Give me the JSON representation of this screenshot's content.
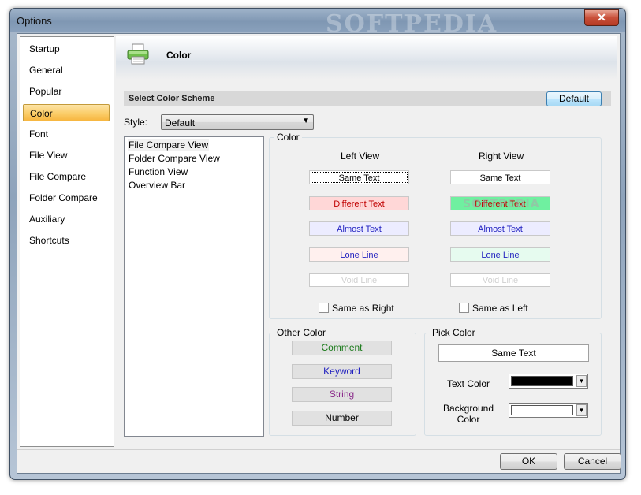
{
  "window": {
    "title": "Options",
    "close_glyph": "✕",
    "titlebar_watermark": "SOFTPEDIA"
  },
  "nav": {
    "items": [
      {
        "label": "Startup"
      },
      {
        "label": "General"
      },
      {
        "label": "Popular"
      },
      {
        "label": "Color",
        "selected": true
      },
      {
        "label": "Font"
      },
      {
        "label": "File View"
      },
      {
        "label": "File Compare"
      },
      {
        "label": "Folder Compare"
      },
      {
        "label": "Auxiliary"
      },
      {
        "label": "Shortcuts"
      }
    ]
  },
  "header": {
    "title": "Color",
    "icon": "printer-icon"
  },
  "scheme": {
    "label": "Select Color Scheme",
    "default_button": "Default"
  },
  "style": {
    "label": "Style:",
    "value": "Default"
  },
  "view_list": {
    "items": [
      {
        "label": "File Compare View",
        "selected": true
      },
      {
        "label": "Folder Compare View"
      },
      {
        "label": "Function View"
      },
      {
        "label": "Overview Bar"
      }
    ]
  },
  "color_group": {
    "title": "Color",
    "left_view": {
      "label": "Left View",
      "samples": [
        {
          "text": "Same Text",
          "fg": "#000000",
          "bg": "#ffffff",
          "focused": true
        },
        {
          "text": "Different Text",
          "fg": "#c00000",
          "bg": "#ffd7d7"
        },
        {
          "text": "Almost Text",
          "fg": "#1f1fbf",
          "bg": "#ececff"
        },
        {
          "text": "Lone Line",
          "fg": "#1f1fbf",
          "bg": "#fff0ee"
        },
        {
          "text": "Void Line",
          "fg": "#d0d0d0",
          "bg": "#ffffff"
        }
      ],
      "checkbox": "Same as Right"
    },
    "right_view": {
      "label": "Right View",
      "samples": [
        {
          "text": "Same Text",
          "fg": "#000000",
          "bg": "#ffffff"
        },
        {
          "text": "Different Text",
          "fg": "#c00000",
          "bg": "#6ff0a0"
        },
        {
          "text": "Almost Text",
          "fg": "#1f1fbf",
          "bg": "#ececff"
        },
        {
          "text": "Lone Line",
          "fg": "#1f1fbf",
          "bg": "#e6fbef"
        },
        {
          "text": "Void Line",
          "fg": "#d0d0d0",
          "bg": "#ffffff"
        }
      ],
      "checkbox": "Same as Left"
    },
    "watermark": "SOFTPEDIA"
  },
  "other_color": {
    "title": "Other Color",
    "buttons": [
      {
        "label": "Comment",
        "fg": "#1a7a1a"
      },
      {
        "label": "Keyword",
        "fg": "#1f1fbf"
      },
      {
        "label": "String",
        "fg": "#8a2a8a"
      },
      {
        "label": "Number",
        "fg": "#000000"
      }
    ]
  },
  "pick_color": {
    "title": "Pick Color",
    "sample": "Same Text",
    "text_color_label": "Text Color",
    "text_color": "#000000",
    "background_color_label": "Background Color",
    "background_color": "#ffffff"
  },
  "footer": {
    "ok": "OK",
    "cancel": "Cancel"
  }
}
